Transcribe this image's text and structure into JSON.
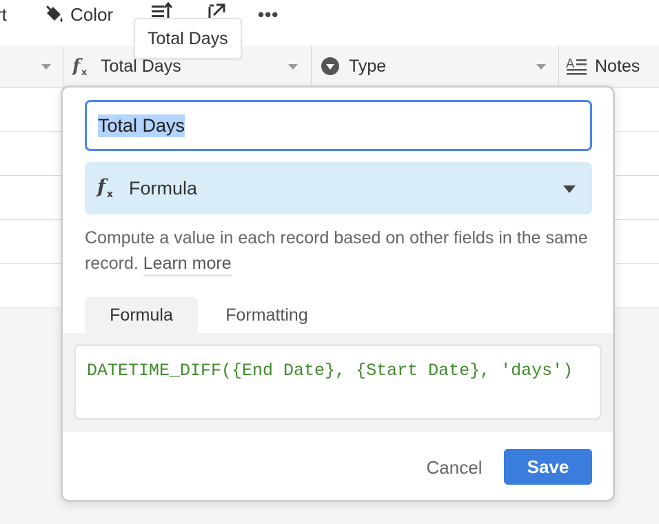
{
  "toolbar": {
    "sort_label": "rt",
    "color_label": "Color",
    "more_label": "•••",
    "row_height_icon": "row-height-icon",
    "share_icon": "share-view-icon"
  },
  "tooltip": {
    "text": "Total Days"
  },
  "columns": [
    {
      "label": "",
      "icon": "none"
    },
    {
      "label": "Total Days",
      "icon": "formula-icon"
    },
    {
      "label": "Type",
      "icon": "single-select-icon"
    },
    {
      "label": "Notes",
      "icon": "long-text-icon"
    }
  ],
  "popup": {
    "field_name": "Total Days",
    "field_type": "Formula",
    "description": "Compute a value in each record based on other fields in the same record.",
    "learn_more": "Learn more",
    "tabs": [
      "Formula",
      "Formatting"
    ],
    "active_tab": "Formula",
    "formula": "DATETIME_DIFF({End Date}, {Start Date}, 'days')",
    "cancel_label": "Cancel",
    "save_label": "Save"
  },
  "colors": {
    "accent": "#3b7ddd",
    "focus_border": "#4a86e8",
    "type_select_bg": "#d8edf8",
    "formula_text": "#3f8a2a"
  }
}
